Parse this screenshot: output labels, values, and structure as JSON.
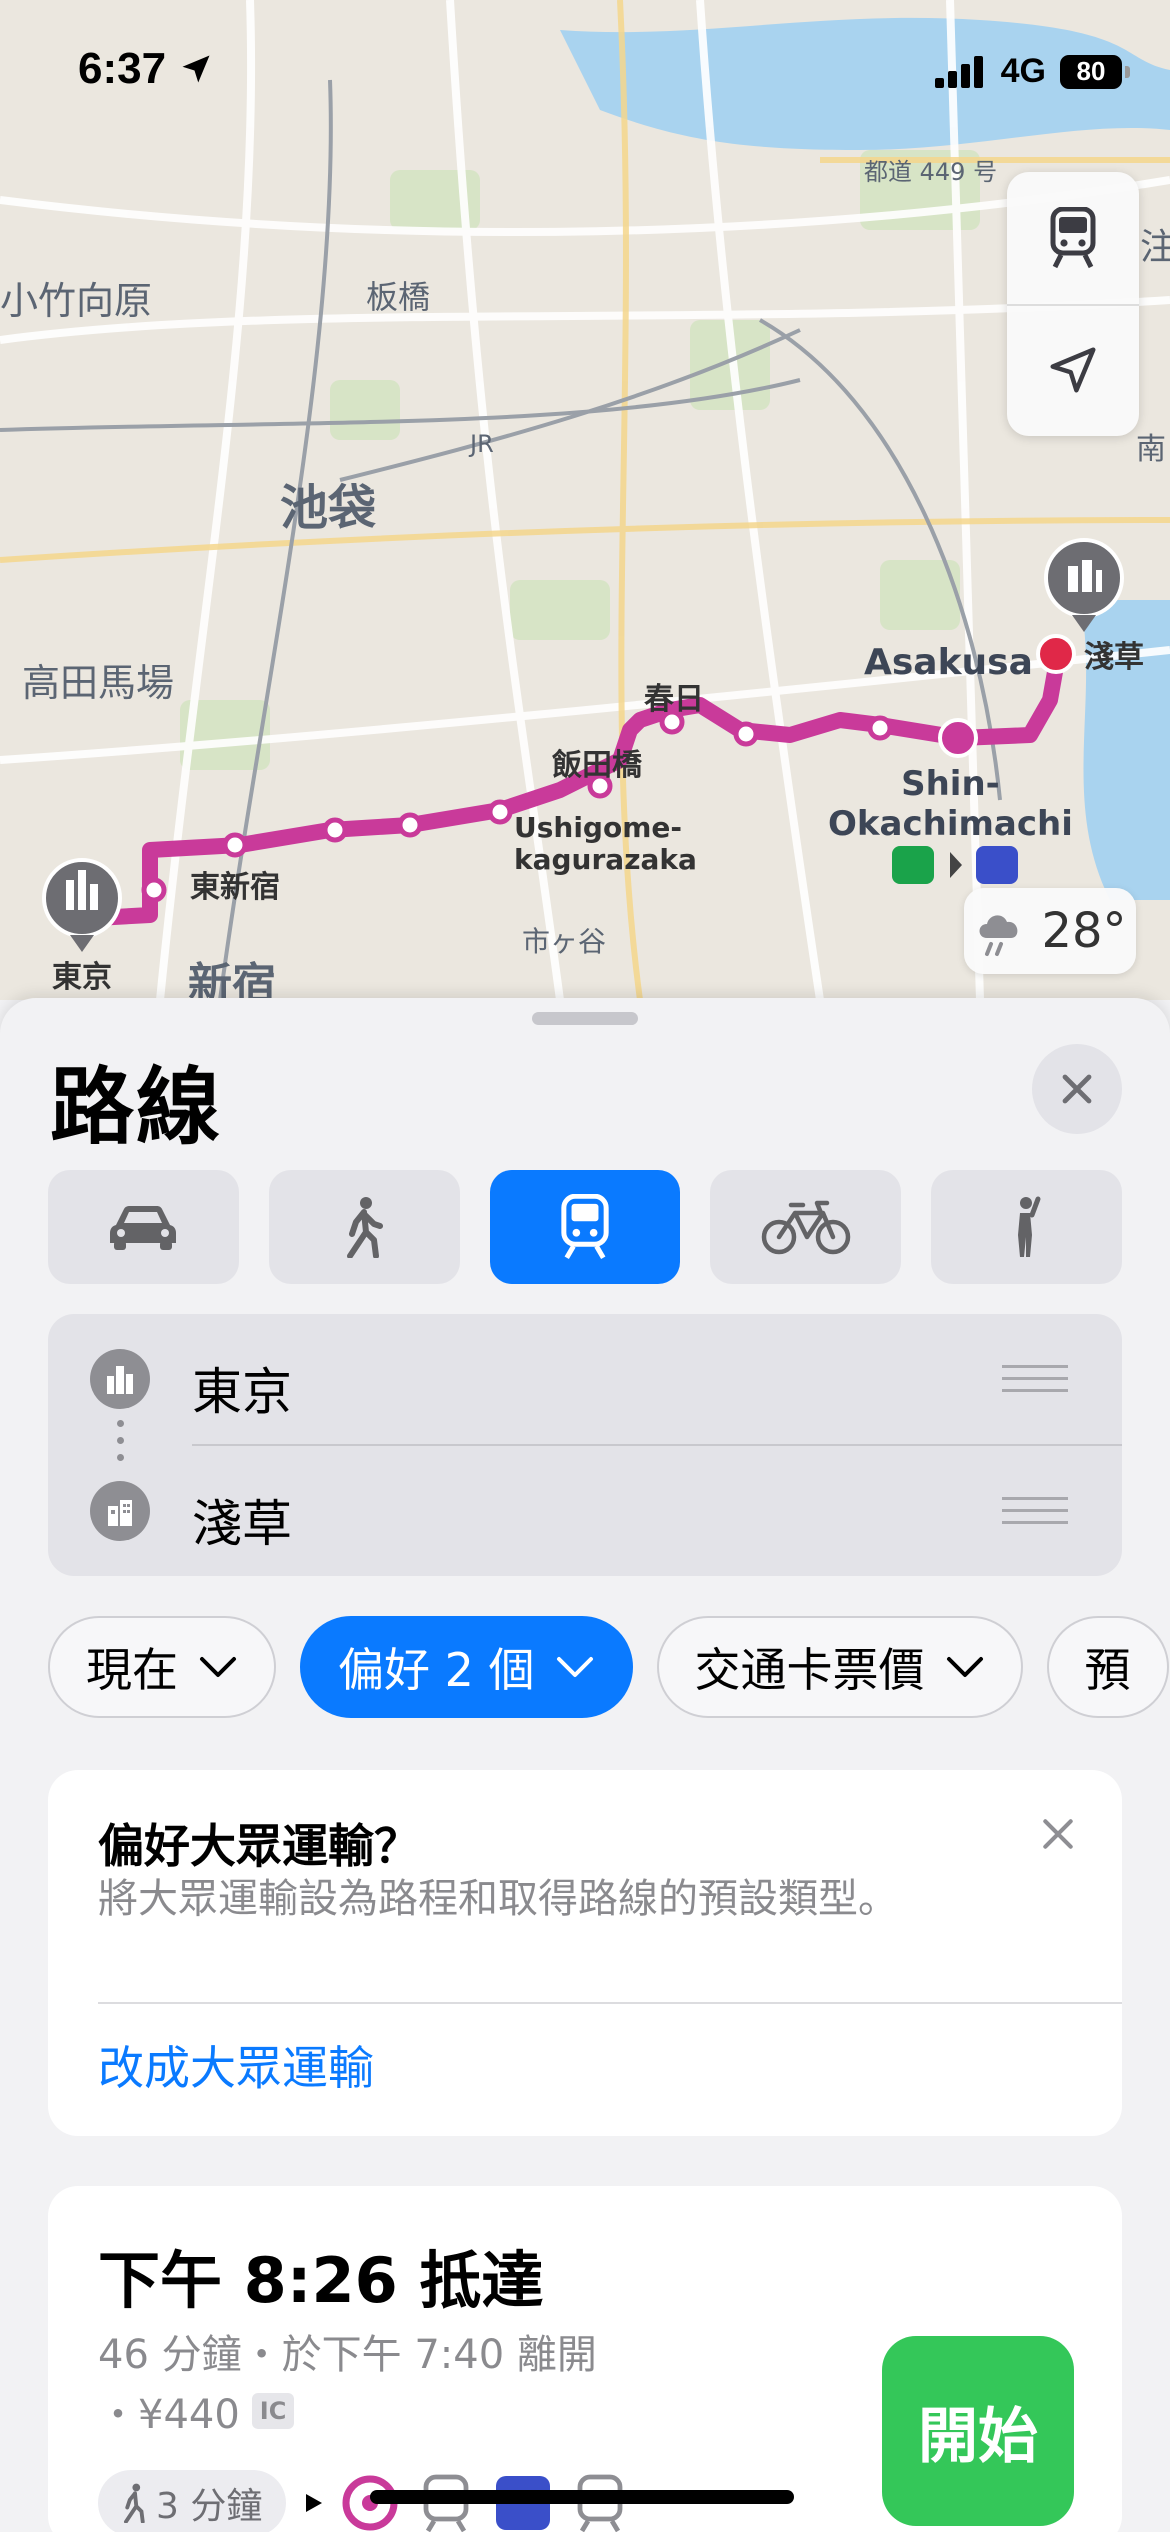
{
  "status_bar": {
    "time": "6:37",
    "network": "4G",
    "battery": "80"
  },
  "map": {
    "labels": {
      "komagome": "小竹向原",
      "itabashi": "板橋",
      "ikebukuro": "池袋",
      "takadanobaba": "高田馬場",
      "higashi_shinjuku": "東新宿",
      "tokyo_pin": "東京",
      "shinjuku": "新宿",
      "kasuga": "春日",
      "iidabashi": "飯田橋",
      "ushigome": "Ushigome-\nkagurazaka",
      "ichigaya": "市ヶ谷",
      "asakusa_en": "Asakusa",
      "asakusa_pin": "淺草",
      "shin_okachimachi": "Shin-\nOkachimachi",
      "road_449": "都道 449 号",
      "jr": "JR",
      "minami": "南",
      "right_edge": "注"
    },
    "weather_temp": "28°",
    "route_color": "#c93a9a"
  },
  "sheet": {
    "title": "路線",
    "modes": [
      "car",
      "walk",
      "transit",
      "bike",
      "rideshare"
    ],
    "active_mode": "transit",
    "origin": "東京",
    "destination": "淺草",
    "chips": [
      {
        "label": "現在",
        "active": false
      },
      {
        "label": "偏好 2 個",
        "active": true
      },
      {
        "label": "交通卡票價",
        "active": false
      },
      {
        "label": "預",
        "active": false
      }
    ],
    "preference_card": {
      "title": "偏好大眾運輸？",
      "description": "將大眾運輸設為路程和取得路線的預設類型。",
      "link": "改成大眾運輸"
    },
    "route_card": {
      "arrival": "下午 8:26 抵達",
      "duration": "46 分鐘・於下午 7:40 離開",
      "fare": "・¥440",
      "ic_badge": "IC",
      "walk": "3 分鐘",
      "start_label": "開始"
    }
  }
}
